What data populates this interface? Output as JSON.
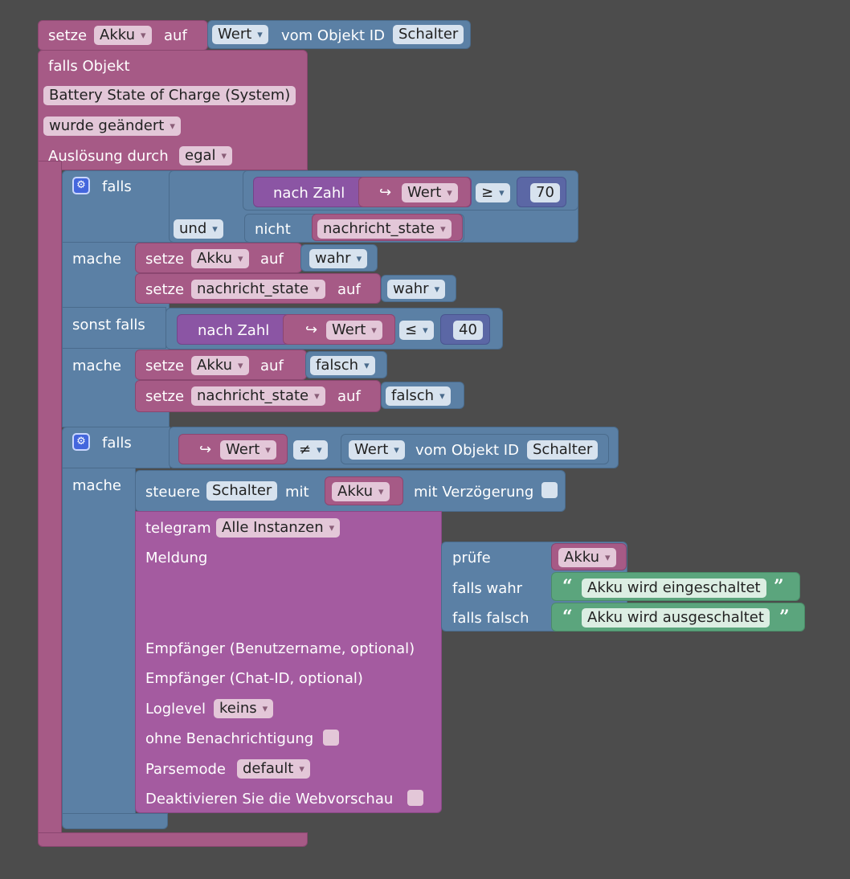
{
  "main": {
    "setze": "setze",
    "var": "Akku",
    "auf": "auf",
    "wert": "Wert",
    "vom_objekt": "vom Objekt ID",
    "objekt": "Schalter"
  },
  "trigger": {
    "falls_objekt": "falls Objekt",
    "objekt_name": "Battery State of Charge (System)",
    "wurde": "wurde geändert",
    "ausloesung": "Auslösung durch",
    "egal": "egal"
  },
  "if1": {
    "falls": "falls",
    "nach_zahl": "nach Zahl",
    "wert": "Wert",
    "op": "≥",
    "num": "70",
    "und": "und",
    "nicht": "nicht",
    "state_var": "nachricht_state",
    "mache": "mache",
    "set1_setze": "setze",
    "set1_var": "Akku",
    "set1_auf": "auf",
    "set1_val": "wahr",
    "set2_setze": "setze",
    "set2_var": "nachricht_state",
    "set2_auf": "auf",
    "set2_val": "wahr",
    "sonst_falls": "sonst falls",
    "nach_zahl2": "nach Zahl",
    "wert2": "Wert",
    "op2": "≤",
    "num2": "40",
    "mache2": "mache",
    "set3_setze": "setze",
    "set3_var": "Akku",
    "set3_auf": "auf",
    "set3_val": "falsch",
    "set4_setze": "setze",
    "set4_var": "nachricht_state",
    "set4_auf": "auf",
    "set4_val": "falsch"
  },
  "if2": {
    "falls": "falls",
    "wert": "Wert",
    "op": "≠",
    "wert2": "Wert",
    "vom_objekt": "vom Objekt ID",
    "objekt": "Schalter",
    "mache": "mache",
    "steuere": "steuere",
    "steuere_obj": "Schalter",
    "mit": "mit",
    "mit_var": "Akku",
    "verzoegerung": "mit Verzögerung"
  },
  "telegram": {
    "label": "telegram",
    "instanz": "Alle Instanzen",
    "meldung": "Meldung",
    "pruefe": "prüfe",
    "pruefe_var": "Akku",
    "falls_wahr": "falls wahr",
    "text_wahr": "Akku wird eingeschaltet",
    "falls_falsch": "falls falsch",
    "text_falsch": "Akku wird ausgeschaltet",
    "empf_user": "Empfänger (Benutzername, optional)",
    "empf_chat": "Empfänger (Chat-ID, optional)",
    "loglevel": "Loglevel",
    "loglevel_val": "keins",
    "ohne_ben": "ohne Benachrichtigung",
    "parsemode": "Parsemode",
    "parsemode_val": "default",
    "webvorschau": "Deaktivieren Sie die Webvorschau"
  },
  "icons": {
    "gear": "gear-icon",
    "arrow": "return-arrow-icon",
    "quote_open": "quote-open-icon",
    "quote_close": "quote-close-icon"
  },
  "colors": {
    "background": "#4c4c4c",
    "variable": "#a65a86",
    "logic": "#5b80a5",
    "math": "#8b55a4",
    "telegram": "#a45ba0",
    "text": "#5ba57d"
  }
}
